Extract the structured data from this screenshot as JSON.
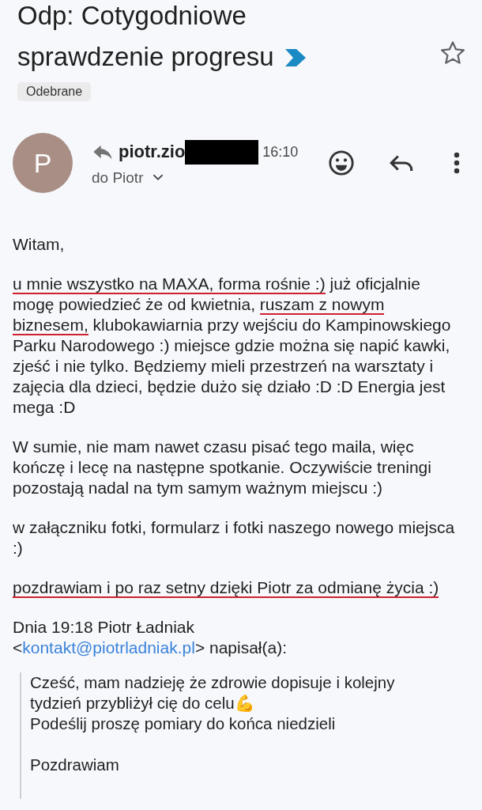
{
  "subject": "Odp: Cotygodniowe sprawdzenie progresu",
  "important": true,
  "starred": false,
  "label": "Odebrane",
  "sender": {
    "initial": "P",
    "name": "piotr.zio",
    "redacted": true,
    "replied": true,
    "time": "16:10",
    "recipient": "do Piotr"
  },
  "body": [
    {
      "segments": [
        {
          "text": "Witam,",
          "underlined": false
        }
      ]
    },
    {
      "segments": [
        {
          "text": "u mnie wszystko na MAXA, forma rośnie :)",
          "underlined": true
        },
        {
          "text": " już oficjalnie mogę powiedzieć że od kwietnia, ",
          "underlined": false
        },
        {
          "text": "ruszam z nowym biznesem,",
          "underlined": true
        },
        {
          "text": " klubokawiarnia przy wejściu do Kampinowskiego Parku Narodowego :) miejsce gdzie można się napić kawki, zjeść i nie tylko. Będziemy mieli przestrzeń na warsztaty i zajęcia dla dzieci, będzie dużo się działo :D :D Energia jest mega :D",
          "underlined": false
        }
      ]
    },
    {
      "segments": [
        {
          "text": "W sumie, nie mam nawet czasu pisać tego maila, więc kończę i lecę na następne spotkanie. Oczywiście treningi pozostają nadal na tym samym ważnym miejscu :)",
          "underlined": false
        }
      ]
    },
    {
      "segments": [
        {
          "text": "w załączniku fotki, formularz i fotki naszego nowego miejsca :)",
          "underlined": false
        }
      ]
    },
    {
      "segments": [
        {
          "text": "pozdrawiam i po raz setny dzięki Piotr za odmianę życia :)",
          "underlined": true
        }
      ]
    }
  ],
  "attribution": {
    "line": "Dnia 19:18 Piotr Ładniak",
    "before": "<",
    "email": "kontakt@piotrladniak.pl",
    "after": "> napisał(a):"
  },
  "quote": [
    {
      "lines": [
        "Cześć, mam nadzieję że zdrowie dopisuje i kolejny tydzień przybliżył cię do celu💪",
        "Podeślij proszę pomiary do końca niedzieli"
      ]
    },
    {
      "lines": [
        "Pozdrawiam"
      ]
    }
  ]
}
